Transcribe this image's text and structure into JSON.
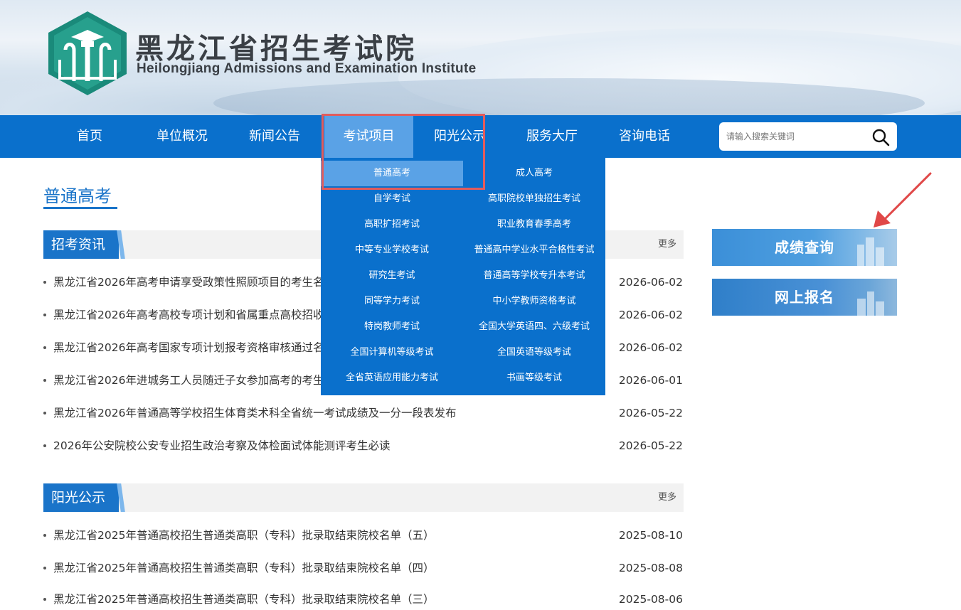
{
  "header": {
    "title_cn": "黑龙江省招生考试院",
    "title_en": "Heilongjiang Admissions and Examination Institute"
  },
  "nav": {
    "items": [
      {
        "label": "首页"
      },
      {
        "label": "单位概况"
      },
      {
        "label": "新闻公告"
      },
      {
        "label": "考试项目"
      },
      {
        "label": "阳光公示"
      },
      {
        "label": "服务大厅"
      },
      {
        "label": "咨询电话"
      }
    ],
    "active_index": 3,
    "search_placeholder": "请输入搜索关键词"
  },
  "dropdown": {
    "items": [
      {
        "label": "普通高考"
      },
      {
        "label": "成人高考"
      },
      {
        "label": "自学考试"
      },
      {
        "label": "高职院校单独招生考试"
      },
      {
        "label": "高职扩招考试"
      },
      {
        "label": "职业教育春季高考"
      },
      {
        "label": "中等专业学校考试"
      },
      {
        "label": "普通高中学业水平合格性考试"
      },
      {
        "label": "研究生考试"
      },
      {
        "label": "普通高等学校专升本考试"
      },
      {
        "label": "同等学力考试"
      },
      {
        "label": "中小学教师资格考试"
      },
      {
        "label": "特岗教师考试"
      },
      {
        "label": "全国大学英语四、六级考试"
      },
      {
        "label": "全国计算机等级考试"
      },
      {
        "label": "全国英语等级考试"
      },
      {
        "label": "全省英语应用能力考试"
      },
      {
        "label": "书画等级考试"
      }
    ],
    "selected_index": 0
  },
  "page_title": "普通高考",
  "sections": [
    {
      "title": "招考资讯",
      "more": "更多",
      "rows": [
        {
          "title": "黑龙江省2026年高考申请享受政策性照顾项目的考生名",
          "date": "2026-06-02"
        },
        {
          "title": "黑龙江省2026年高考高校专项计划和省属重点高校招收",
          "date": "2026-06-02"
        },
        {
          "title": "黑龙江省2026年高考国家专项计划报考资格审核通过名",
          "date": "2026-06-02"
        },
        {
          "title": "黑龙江省2026年进城务工人员随迁子女参加高考的考生",
          "date": "2026-06-01"
        },
        {
          "title": "黑龙江省2026年普通高等学校招生体育类术科全省统一考试成绩及一分一段表发布",
          "date": "2026-05-22"
        },
        {
          "title": "2026年公安院校公安专业招生政治考察及体检面试体能测评考生必读",
          "date": "2026-05-22"
        }
      ]
    },
    {
      "title": "阳光公示",
      "more": "更多",
      "rows": [
        {
          "title": "黑龙江省2025年普通高校招生普通类高职（专科）批录取结束院校名单（五）",
          "date": "2025-08-10"
        },
        {
          "title": "黑龙江省2025年普通高校招生普通类高职（专科）批录取结束院校名单（四）",
          "date": "2025-08-08"
        },
        {
          "title": "黑龙江省2025年普通高校招生普通类高职（专科）批录取结束院校名单（三）",
          "date": "2025-08-06"
        }
      ]
    }
  ],
  "side": {
    "score_label": "成绩查询",
    "apply_label": "网上报名"
  },
  "colors": {
    "nav_bg": "#0a70cc",
    "active_bg": "#5aa2e6",
    "highlight": "#e25c5c"
  }
}
